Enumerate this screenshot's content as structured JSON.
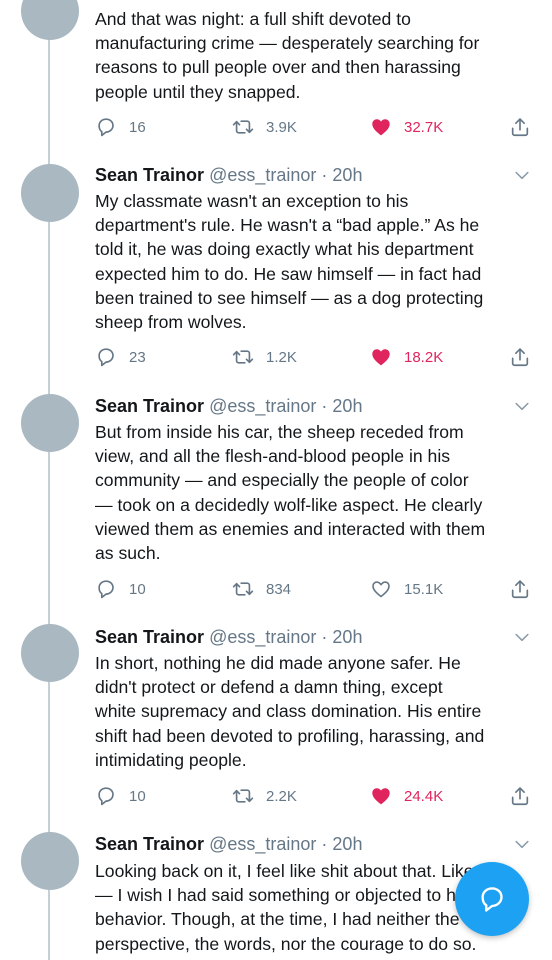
{
  "tweets": [
    {
      "lines": [
        "And that was night: a full shift devoted to",
        "manufacturing crime — desperately searching for",
        "reasons to pull people over and then harassing",
        "people until they snapped."
      ],
      "replies": "16",
      "retweets": "3.9K",
      "likes": "32.7K",
      "liked": true
    },
    {
      "name": "Sean Trainor",
      "handle": "@ess_trainor",
      "separator": "·",
      "time": "20h",
      "lines": [
        "My classmate wasn't an exception to his",
        "department's rule. He wasn't a “bad apple.” As he",
        "told it, he was doing exactly what his department",
        "expected him to do. He saw himself — in fact had",
        "been trained to see himself — as a dog protecting",
        "sheep from wolves."
      ],
      "replies": "23",
      "retweets": "1.2K",
      "likes": "18.2K",
      "liked": true
    },
    {
      "name": "Sean Trainor",
      "handle": "@ess_trainor",
      "separator": "·",
      "time": "20h",
      "lines": [
        "But from inside his car, the sheep receded from",
        "view, and all the flesh-and-blood people in his",
        "community — and especially the people of color",
        "— took on a decidedly wolf-like aspect. He clearly",
        "viewed them as enemies and interacted with them",
        "as such."
      ],
      "replies": "10",
      "retweets": "834",
      "likes": "15.1K",
      "liked": false
    },
    {
      "name": "Sean Trainor",
      "handle": "@ess_trainor",
      "separator": "·",
      "time": "20h",
      "lines": [
        "In short, nothing he did made anyone safer. He",
        "didn't protect or defend a damn thing, except",
        "white supremacy and class domination. His entire",
        "shift had been devoted to profiling, harassing, and",
        "intimidating people."
      ],
      "replies": "10",
      "retweets": "2.2K",
      "likes": "24.4K",
      "liked": true
    },
    {
      "name": "Sean Trainor",
      "handle": "@ess_trainor",
      "separator": "·",
      "time": "20h",
      "lines": [
        "Looking back on it, I feel like shit about that. Like",
        "— I wish I had said something or objected to his",
        "behavior. Though, at the time, I had neither the",
        "perspective, the words, nor the courage to do so."
      ]
    }
  ],
  "icons": {
    "reply": "reply-icon",
    "retweet": "retweet-icon",
    "like": "heart-icon",
    "share": "share-icon",
    "more": "chevron-down-icon",
    "compose": "compose-reply-icon"
  },
  "colors": {
    "like_active": "#e0245e",
    "muted": "#657786",
    "accent": "#1da1f2",
    "avatar_placeholder": "#aab8c2"
  }
}
